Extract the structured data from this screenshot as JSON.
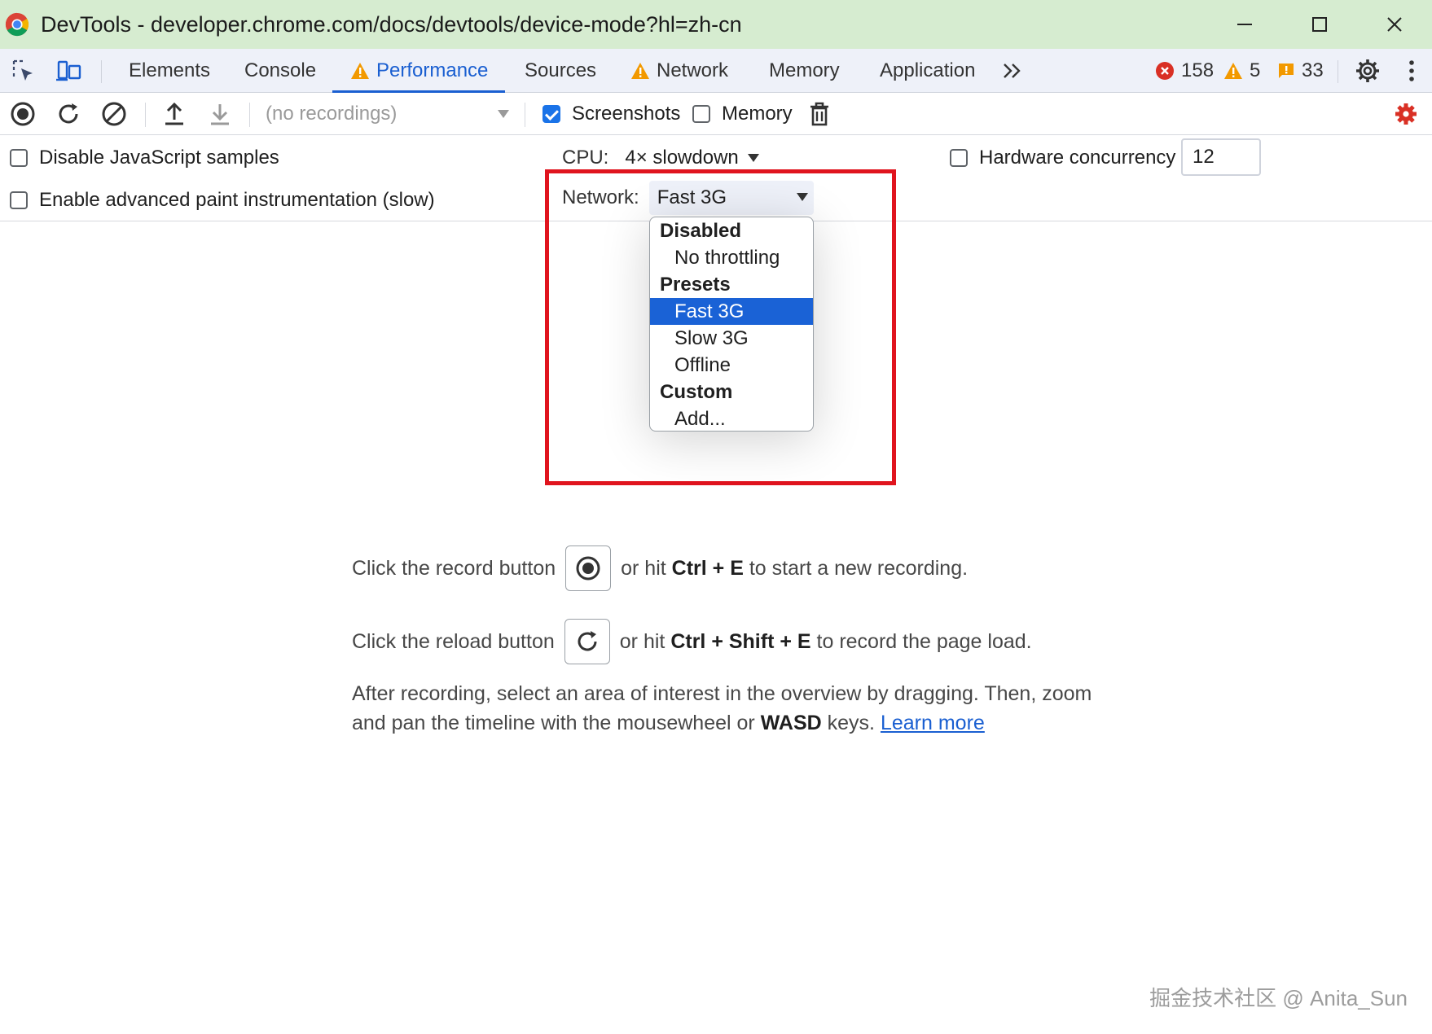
{
  "window": {
    "title": "DevTools - developer.chrome.com/docs/devtools/device-mode?hl=zh-cn"
  },
  "tabs": [
    {
      "label": "Elements",
      "warning": false,
      "active": false
    },
    {
      "label": "Console",
      "warning": false,
      "active": false
    },
    {
      "label": "Performance",
      "warning": true,
      "active": true
    },
    {
      "label": "Sources",
      "warning": false,
      "active": false
    },
    {
      "label": "Network",
      "warning": true,
      "active": false
    },
    {
      "label": "Memory",
      "warning": false,
      "active": false
    },
    {
      "label": "Application",
      "warning": false,
      "active": false
    }
  ],
  "counters": {
    "errors": "158",
    "warnings": "5",
    "issues": "33"
  },
  "toolbar": {
    "recordings_placeholder": "(no recordings)",
    "screenshots_label": "Screenshots",
    "screenshots_checked": true,
    "memory_label": "Memory",
    "memory_checked": false
  },
  "settings": {
    "disable_js_samples": "Disable JavaScript samples",
    "advanced_paint": "Enable advanced paint instrumentation (slow)",
    "cpu_label": "CPU:",
    "cpu_value": "4× slowdown",
    "hw_concurrency_label": "Hardware concurrency",
    "hw_concurrency_value": "12",
    "network_label": "Network:",
    "network_value": "Fast 3G"
  },
  "network_dropdown": [
    {
      "type": "group",
      "label": "Disabled"
    },
    {
      "type": "option",
      "label": "No throttling",
      "selected": false
    },
    {
      "type": "group",
      "label": "Presets"
    },
    {
      "type": "option",
      "label": "Fast 3G",
      "selected": true
    },
    {
      "type": "option",
      "label": "Slow 3G",
      "selected": false
    },
    {
      "type": "option",
      "label": "Offline",
      "selected": false
    },
    {
      "type": "group",
      "label": "Custom"
    },
    {
      "type": "option",
      "label": "Add...",
      "selected": false
    }
  ],
  "landing": {
    "record_pre": "Click the record button",
    "record_or": "or hit",
    "record_keys": "Ctrl + E",
    "record_post": "to start a new recording.",
    "reload_pre": "Click the reload button",
    "reload_or": "or hit",
    "reload_keys": "Ctrl + Shift + E",
    "reload_post": "to record the page load.",
    "para_1": "After recording, select an area of interest in the overview by dragging. Then, zoom and pan the timeline with the mousewheel or",
    "para_keys": "WASD",
    "para_2": "keys.",
    "learn_more": "Learn more"
  },
  "watermark": "掘金技术社区 @ Anita_Sun",
  "colors": {
    "accent": "#1a5fd1",
    "highlight": "#e0141e",
    "titlebar_bg": "#d6ecd0",
    "error": "#d93025",
    "warning": "#f29900"
  }
}
